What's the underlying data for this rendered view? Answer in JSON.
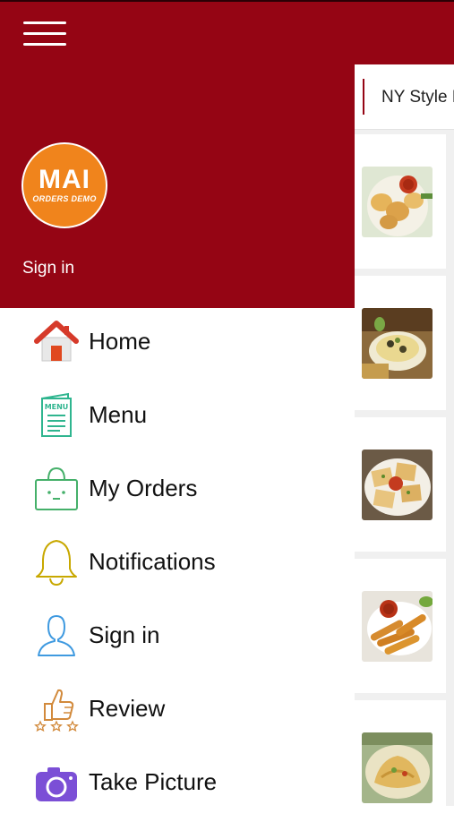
{
  "header": {
    "menu_icon": "hamburger-icon",
    "accent_color": "#950514"
  },
  "background": {
    "tab_label": "NY Style P"
  },
  "drawer": {
    "logo": {
      "line1": "MAI",
      "line2": "ORDERS DEMO",
      "color": "#f0841c"
    },
    "signin_label": "Sign in",
    "items": [
      {
        "label": "Home",
        "icon": "house-icon"
      },
      {
        "label": "Menu",
        "icon": "menu-card-icon"
      },
      {
        "label": "My Orders",
        "icon": "shopping-bag-icon"
      },
      {
        "label": "Notifications",
        "icon": "bell-icon"
      },
      {
        "label": "Sign in",
        "icon": "user-icon"
      },
      {
        "label": "Review",
        "icon": "thumbs-up-stars-icon"
      },
      {
        "label": "Take Picture",
        "icon": "camera-icon"
      }
    ]
  }
}
